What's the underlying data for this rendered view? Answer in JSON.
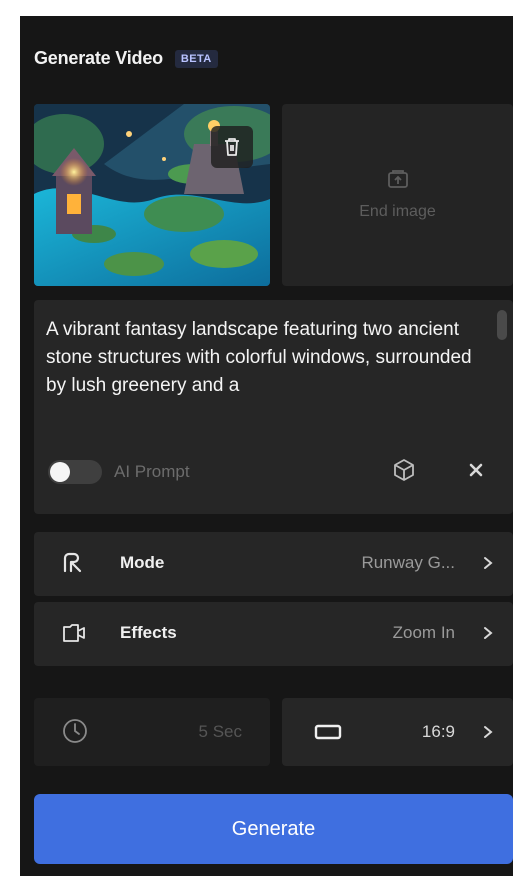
{
  "header": {
    "title": "Generate Video",
    "badge": "BETA"
  },
  "images": {
    "end_label": "End image"
  },
  "prompt": {
    "text": "A vibrant fantasy landscape featuring two ancient stone structures with colorful windows, surrounded by lush greenery and a",
    "ai_prompt_label": "AI Prompt",
    "ai_prompt_enabled": false
  },
  "settings": {
    "mode": {
      "label": "Mode",
      "value": "Runway G..."
    },
    "effects": {
      "label": "Effects",
      "value": "Zoom In"
    }
  },
  "duration": {
    "value": "5 Sec"
  },
  "aspect_ratio": {
    "value": "16:9"
  },
  "actions": {
    "generate_label": "Generate"
  },
  "colors": {
    "panel_bg": "#161616",
    "card_bg": "#262626",
    "accent": "#3f6fe0",
    "badge_text": "#b9c3ff"
  }
}
